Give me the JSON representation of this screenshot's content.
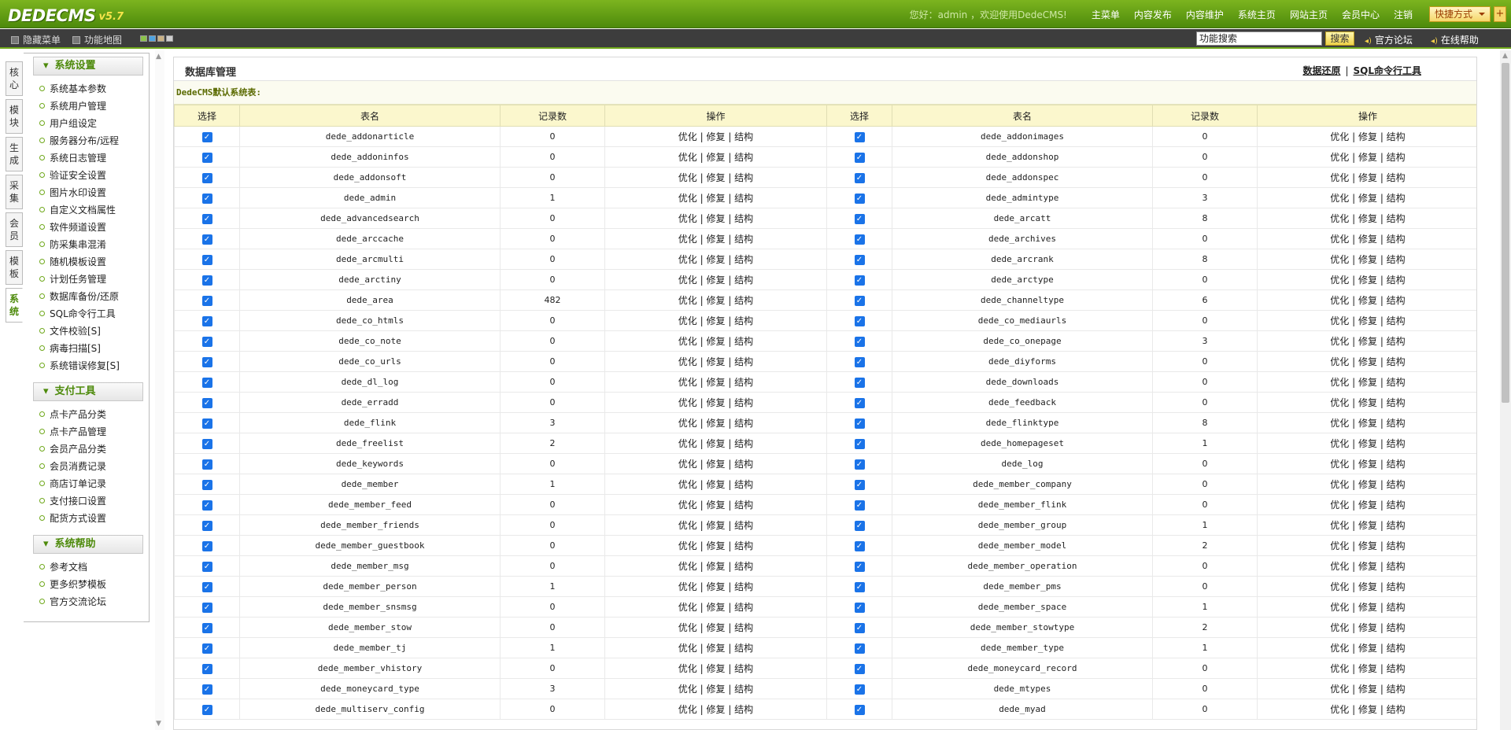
{
  "header": {
    "logo_text": "DEDECMS",
    "version": "v5.7",
    "welcome": "您好：admin ，欢迎使用DedeCMS!",
    "nav": [
      "主菜单",
      "内容发布",
      "内容维护",
      "系统主页",
      "网站主页",
      "会员中心",
      "注销"
    ],
    "quick_label": "快捷方式",
    "quick_plus": "+"
  },
  "toolbar": {
    "hide_menu": "隐藏菜单",
    "func_map": "功能地图",
    "search_value": "功能搜索",
    "search_button": "搜索",
    "forum": "官方论坛",
    "help": "在线帮助"
  },
  "left_tabs": [
    "核心",
    "模块",
    "生成",
    "采集",
    "会员",
    "模板",
    "系统"
  ],
  "menu": {
    "sections": [
      {
        "title": "系统设置",
        "items": [
          "系统基本参数",
          "系统用户管理",
          "用户组设定",
          "服务器分布/远程",
          "系统日志管理",
          "验证安全设置",
          "图片水印设置",
          "自定义文档属性",
          "软件频道设置",
          "防采集串混淆",
          "随机模板设置",
          "计划任务管理",
          "数据库备份/还原",
          "SQL命令行工具",
          "文件校验[S]",
          "病毒扫描[S]",
          "系统错误修复[S]"
        ]
      },
      {
        "title": "支付工具",
        "items": [
          "点卡产品分类",
          "点卡产品管理",
          "会员产品分类",
          "会员消费记录",
          "商店订单记录",
          "支付接口设置",
          "配货方式设置"
        ]
      },
      {
        "title": "系统帮助",
        "items": [
          "参考文档",
          "更多织梦模板",
          "官方交流论坛"
        ]
      }
    ]
  },
  "main": {
    "title": "数据库管理",
    "link_restore": "数据还原",
    "link_sep": "|",
    "link_sql": "SQL命令行工具",
    "subtitle": "DedeCMS默认系统表:",
    "headers": [
      "选择",
      "表名",
      "记录数",
      "操作",
      "选择",
      "表名",
      "记录数",
      "操作"
    ],
    "ops": [
      "优化",
      "修复",
      "结构"
    ],
    "rows": [
      [
        "dede_addonarticle",
        "0",
        "dede_addonimages",
        "0"
      ],
      [
        "dede_addoninfos",
        "0",
        "dede_addonshop",
        "0"
      ],
      [
        "dede_addonsoft",
        "0",
        "dede_addonspec",
        "0"
      ],
      [
        "dede_admin",
        "1",
        "dede_admintype",
        "3"
      ],
      [
        "dede_advancedsearch",
        "0",
        "dede_arcatt",
        "8"
      ],
      [
        "dede_arccache",
        "0",
        "dede_archives",
        "0"
      ],
      [
        "dede_arcmulti",
        "0",
        "dede_arcrank",
        "8"
      ],
      [
        "dede_arctiny",
        "0",
        "dede_arctype",
        "0"
      ],
      [
        "dede_area",
        "482",
        "dede_channeltype",
        "6"
      ],
      [
        "dede_co_htmls",
        "0",
        "dede_co_mediaurls",
        "0"
      ],
      [
        "dede_co_note",
        "0",
        "dede_co_onepage",
        "3"
      ],
      [
        "dede_co_urls",
        "0",
        "dede_diyforms",
        "0"
      ],
      [
        "dede_dl_log",
        "0",
        "dede_downloads",
        "0"
      ],
      [
        "dede_erradd",
        "0",
        "dede_feedback",
        "0"
      ],
      [
        "dede_flink",
        "3",
        "dede_flinktype",
        "8"
      ],
      [
        "dede_freelist",
        "2",
        "dede_homepageset",
        "1"
      ],
      [
        "dede_keywords",
        "0",
        "dede_log",
        "0"
      ],
      [
        "dede_member",
        "1",
        "dede_member_company",
        "0"
      ],
      [
        "dede_member_feed",
        "0",
        "dede_member_flink",
        "0"
      ],
      [
        "dede_member_friends",
        "0",
        "dede_member_group",
        "1"
      ],
      [
        "dede_member_guestbook",
        "0",
        "dede_member_model",
        "2"
      ],
      [
        "dede_member_msg",
        "0",
        "dede_member_operation",
        "0"
      ],
      [
        "dede_member_person",
        "1",
        "dede_member_pms",
        "0"
      ],
      [
        "dede_member_snsmsg",
        "0",
        "dede_member_space",
        "1"
      ],
      [
        "dede_member_stow",
        "0",
        "dede_member_stowtype",
        "2"
      ],
      [
        "dede_member_tj",
        "1",
        "dede_member_type",
        "1"
      ],
      [
        "dede_member_vhistory",
        "0",
        "dede_moneycard_record",
        "0"
      ],
      [
        "dede_moneycard_type",
        "3",
        "dede_mtypes",
        "0"
      ],
      [
        "dede_multiserv_config",
        "0",
        "dede_myad",
        "0"
      ]
    ]
  }
}
